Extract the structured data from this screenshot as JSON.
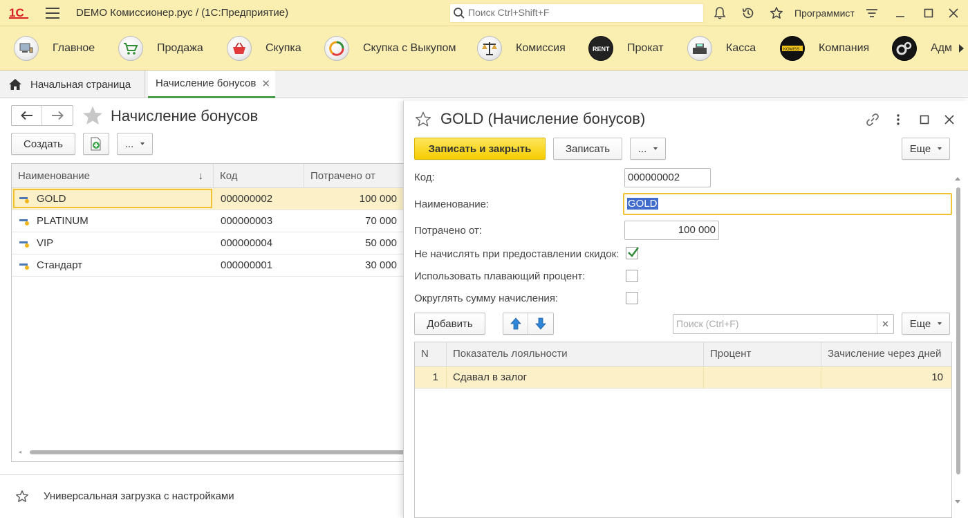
{
  "titlebar": {
    "app_title": "DEMO Комиссионер.рус /   (1С:Предприятие)",
    "search_placeholder": "Поиск Ctrl+Shift+F",
    "username": "Программист"
  },
  "sections": [
    {
      "label": "Главное",
      "icon": "home-desk-icon"
    },
    {
      "label": "Продажа",
      "icon": "shopping-cart-icon"
    },
    {
      "label": "Скупка",
      "icon": "basket-icon"
    },
    {
      "label": "Скупка с Выкупом",
      "icon": "recycle-icon"
    },
    {
      "label": "Комиссия",
      "icon": "scales-icon"
    },
    {
      "label": "Прокат",
      "icon": "rent-icon"
    },
    {
      "label": "Касса",
      "icon": "cash-register-icon"
    },
    {
      "label": "Компания",
      "icon": "company-logo-icon"
    },
    {
      "label": "Адм",
      "icon": "gears-icon"
    }
  ],
  "tabs": {
    "home": "Начальная страница",
    "active": "Начисление бонусов",
    "close_glyph": "✕"
  },
  "list_form": {
    "title": "Начисление бонусов",
    "create_label": "Создать",
    "more_label": "...",
    "columns": [
      "Наименование",
      "Код",
      "Потрачено от"
    ],
    "sort_glyph": "↓",
    "rows": [
      {
        "name": "GOLD",
        "code": "000000002",
        "spent": "100 000"
      },
      {
        "name": "PLATINUM",
        "code": "000000003",
        "spent": "70 000"
      },
      {
        "name": "VIP",
        "code": "000000004",
        "spent": "50 000"
      },
      {
        "name": "Стандарт",
        "code": "000000001",
        "spent": "30 000"
      }
    ],
    "bottom_link": "Универсальная загрузка с настройками"
  },
  "popup": {
    "title": "GOLD (Начисление бонусов)",
    "save_close_label": "Записать и закрыть",
    "save_label": "Записать",
    "more_label": "...",
    "eshe_label": "Еще",
    "fields": {
      "code_label": "Код:",
      "code_value": "000000002",
      "name_label": "Наименование:",
      "name_value": "GOLD",
      "spent_label": "Потрачено от:",
      "spent_value": "100 000",
      "no_accrue_label": "Не начислять при предоставлении скидок:",
      "floating_label": "Использовать плавающий процент:",
      "round_label": "Округлять сумму начисления:"
    },
    "checkboxes": {
      "no_accrue": true,
      "floating": false,
      "round": false
    },
    "table_toolbar": {
      "add_label": "Добавить",
      "search_placeholder": "Поиск (Ctrl+F)",
      "clear_glyph": "✕",
      "eshe_label": "Еще"
    },
    "table": {
      "columns": [
        "N",
        "Показатель лояльности",
        "Процент",
        "Зачисление через дней"
      ],
      "rows": [
        {
          "n": "1",
          "indicator": "Сдавал в залог",
          "percent": "",
          "days": "10"
        }
      ]
    }
  },
  "colors": {
    "panel_bg": "#fbeeb1",
    "primary_button": "#f6cd00",
    "selection_row": "#fbf0c8",
    "focus_border": "#f1c232",
    "active_tab_underline": "#4a9b4a",
    "check_green": "#2e8b3a"
  }
}
